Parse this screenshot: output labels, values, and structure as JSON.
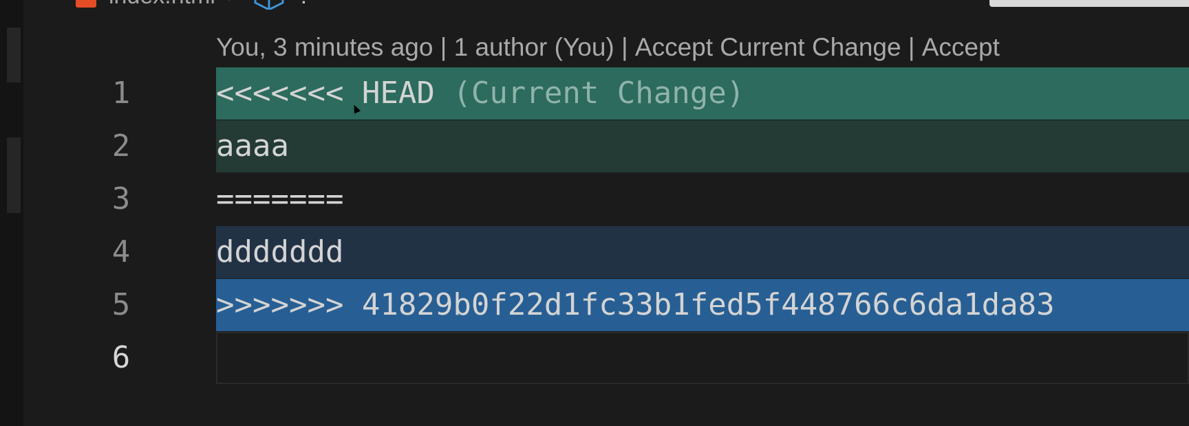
{
  "breadcrumb": {
    "file_name": "index.html",
    "separator": ">",
    "symbol": "?",
    "file_icon": "html5-icon",
    "symbol_icon": "cube-icon"
  },
  "codelens": {
    "author_info": "You, 3 minutes ago",
    "divider": " | ",
    "authors": "1 author (You)",
    "accept_current": "Accept Current Change",
    "accept_incoming_truncated": "Accept"
  },
  "lines": [
    {
      "number": "1",
      "marker": "<<<<<<<",
      "text": " HEAD ",
      "label": "(Current Change)"
    },
    {
      "number": "2",
      "text": "aaaa"
    },
    {
      "number": "3",
      "text": "======="
    },
    {
      "number": "4",
      "text": "ddddddd"
    },
    {
      "number": "5",
      "marker": ">>>>>>>",
      "text": " 41829b0f22d1fc33b1fed5f448766c6da1da83"
    },
    {
      "number": "6",
      "text": ""
    }
  ],
  "colors": {
    "current_marker_bg": "#2c6b5d",
    "current_body_bg": "#233a35",
    "incoming_body_bg": "#223245",
    "incoming_marker_bg": "#275f94",
    "editor_bg": "#1b1b1c"
  }
}
